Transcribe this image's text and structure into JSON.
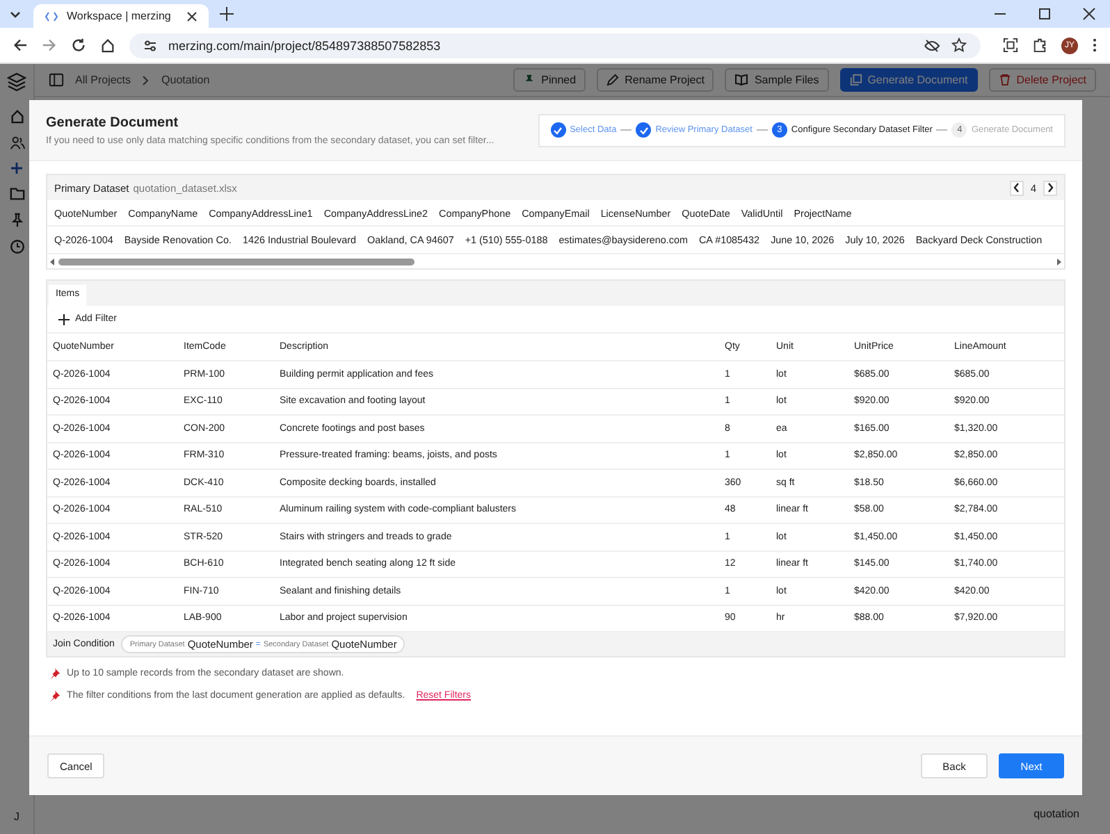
{
  "browser": {
    "tab_title": "Workspace | merzing",
    "url": "merzing.com/main/project/854897388507582853",
    "profile": "JY"
  },
  "app": {
    "breadcrumb": [
      "All Projects",
      "Quotation"
    ],
    "actions": [
      {
        "label": "Pinned",
        "kind": "pin"
      },
      {
        "label": "Rename Project",
        "kind": "rename"
      },
      {
        "label": "Sample Files",
        "kind": "book"
      },
      {
        "label": "Generate Document",
        "kind": "primary"
      },
      {
        "label": "Delete Project",
        "kind": "danger"
      }
    ],
    "sidebar_footer": "J",
    "background_label": "quotation"
  },
  "dialog": {
    "title": "Generate Document",
    "subtitle": "If you need to use only data matching specific conditions from the secondary dataset, you can set filter...",
    "steps": [
      {
        "label": "Select Data",
        "done": true
      },
      {
        "label": "Review Primary Dataset",
        "done": true
      },
      {
        "number": "3",
        "label": "Configure Secondary Dataset Filter",
        "done": false,
        "current": true
      },
      {
        "number": "4",
        "label": "Generate Document",
        "done": false,
        "current": false
      }
    ],
    "primary": {
      "label": "Primary Dataset",
      "file": "quotation_dataset.xlsx",
      "page": "4",
      "columns": [
        "QuoteNumber",
        "CompanyName",
        "CompanyAddressLine1",
        "CompanyAddressLine2",
        "CompanyPhone",
        "CompanyEmail",
        "LicenseNumber",
        "QuoteDate",
        "ValidUntil",
        "ProjectName"
      ],
      "row": [
        "Q-2026-1004",
        "Bayside Renovation Co.",
        "1426 Industrial Boulevard",
        "Oakland, CA 94607",
        "+1 (510) 555-0188",
        "estimates@baysidereno.com",
        "CA #1085432",
        "June 10, 2026",
        "July 10, 2026",
        "Backyard Deck Construction"
      ]
    },
    "tabs": [
      {
        "label": "Items",
        "selected": true
      }
    ],
    "add_filter": "Add Filter",
    "columns": [
      "QuoteNumber",
      "ItemCode",
      "Description",
      "Qty",
      "Unit",
      "UnitPrice",
      "LineAmount"
    ],
    "rows": [
      [
        "Q-2026-1004",
        "PRM-100",
        "Building permit application and fees",
        "1",
        "lot",
        "$685.00",
        "$685.00"
      ],
      [
        "Q-2026-1004",
        "EXC-110",
        "Site excavation and footing layout",
        "1",
        "lot",
        "$920.00",
        "$920.00"
      ],
      [
        "Q-2026-1004",
        "CON-200",
        "Concrete footings and post bases",
        "8",
        "ea",
        "$165.00",
        "$1,320.00"
      ],
      [
        "Q-2026-1004",
        "FRM-310",
        "Pressure-treated framing: beams, joists, and posts",
        "1",
        "lot",
        "$2,850.00",
        "$2,850.00"
      ],
      [
        "Q-2026-1004",
        "DCK-410",
        "Composite decking boards, installed",
        "360",
        "sq ft",
        "$18.50",
        "$6,660.00"
      ],
      [
        "Q-2026-1004",
        "RAL-510",
        "Aluminum railing system with code-compliant balusters",
        "48",
        "linear ft",
        "$58.00",
        "$2,784.00"
      ],
      [
        "Q-2026-1004",
        "STR-520",
        "Stairs with stringers and treads to grade",
        "1",
        "lot",
        "$1,450.00",
        "$1,450.00"
      ],
      [
        "Q-2026-1004",
        "BCH-610",
        "Integrated bench seating along 12 ft side",
        "12",
        "linear ft",
        "$145.00",
        "$1,740.00"
      ],
      [
        "Q-2026-1004",
        "FIN-710",
        "Sealant and finishing details",
        "1",
        "lot",
        "$420.00",
        "$420.00"
      ],
      [
        "Q-2026-1004",
        "LAB-900",
        "Labor and project supervision",
        "90",
        "hr",
        "$88.00",
        "$7,920.00"
      ]
    ],
    "join": {
      "label": "Join Condition",
      "left_source": "Primary Dataset",
      "left_field": "QuoteNumber",
      "operator": "=",
      "right_source": "Secondary Dataset",
      "right_field": "QuoteNumber"
    },
    "notes": [
      {
        "text": "Up to 10 sample records from the secondary dataset are shown."
      },
      {
        "text": "The filter conditions from the last document generation are applied as defaults.",
        "link": "Reset Filters"
      }
    ],
    "buttons": {
      "cancel": "Cancel",
      "back": "Back",
      "next": "Next"
    }
  }
}
